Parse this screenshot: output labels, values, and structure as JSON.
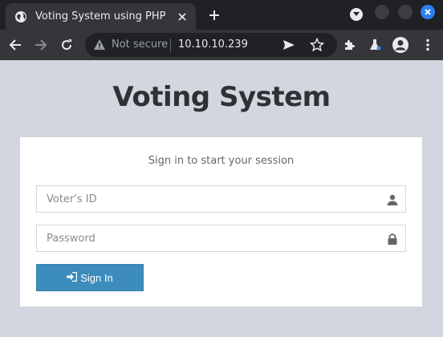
{
  "browser": {
    "tab_title": "Voting System using PHP",
    "security_label": "Not secure",
    "url": "10.10.10.239",
    "icons": [
      "globe-icon",
      "close-icon",
      "plus-icon",
      "chevron-down-icon",
      "back-icon",
      "forward-icon",
      "reload-icon",
      "warning-icon",
      "send-icon",
      "star-icon",
      "puzzle-icon",
      "labs-icon",
      "avatar-icon",
      "menu-icon"
    ]
  },
  "page": {
    "heading": "Voting System",
    "subtitle": "Sign in to start your session",
    "voter_id_placeholder": "Voter's ID",
    "password_placeholder": "Password",
    "signin_label": "Sign In",
    "icons": [
      "user-icon",
      "lock-icon",
      "sign-in-icon"
    ],
    "colors": {
      "background": "#d2d6de",
      "button": "#3c8dbc"
    }
  }
}
